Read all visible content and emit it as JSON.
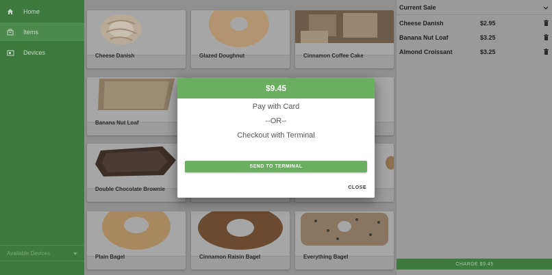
{
  "sidebar": {
    "items": [
      {
        "label": "Home",
        "icon": "home-icon"
      },
      {
        "label": "Items",
        "icon": "items-icon",
        "active": true
      },
      {
        "label": "Devices",
        "icon": "devices-icon"
      }
    ],
    "device_select": {
      "value": "Available Devices"
    }
  },
  "grid": {
    "items": [
      {
        "name": "Cheese Danish"
      },
      {
        "name": "Glazed Doughnut"
      },
      {
        "name": "Cinnamon Coffee Cake"
      },
      {
        "name": "Banana Nut Loaf"
      },
      {
        "name": ""
      },
      {
        "name": ""
      },
      {
        "name": "Double Chocolate Brownie"
      },
      {
        "name": ""
      },
      {
        "name": ""
      },
      {
        "name": "Plain Bagel"
      },
      {
        "name": "Cinnamon Raisin Bagel"
      },
      {
        "name": "Everything Bagel"
      }
    ]
  },
  "sale": {
    "title": "Current Sale",
    "rows": [
      {
        "item": "Cheese Danish",
        "price": "$2.95"
      },
      {
        "item": "Banana Nut Loaf",
        "price": "$3.25"
      },
      {
        "item": "Almond Croissant",
        "price": "$3.25"
      }
    ],
    "charge_label": "CHARGE $9.45"
  },
  "modal": {
    "amount": "$9.45",
    "line1": "Pay with Card",
    "line2": "--OR--",
    "line3": "Checkout with Terminal",
    "send_label": "SEND TO TERMINAL",
    "close_label": "CLOSE"
  },
  "colors": {
    "accent_green": "#6aae5f",
    "sidebar_green": "#3e7a3e"
  }
}
